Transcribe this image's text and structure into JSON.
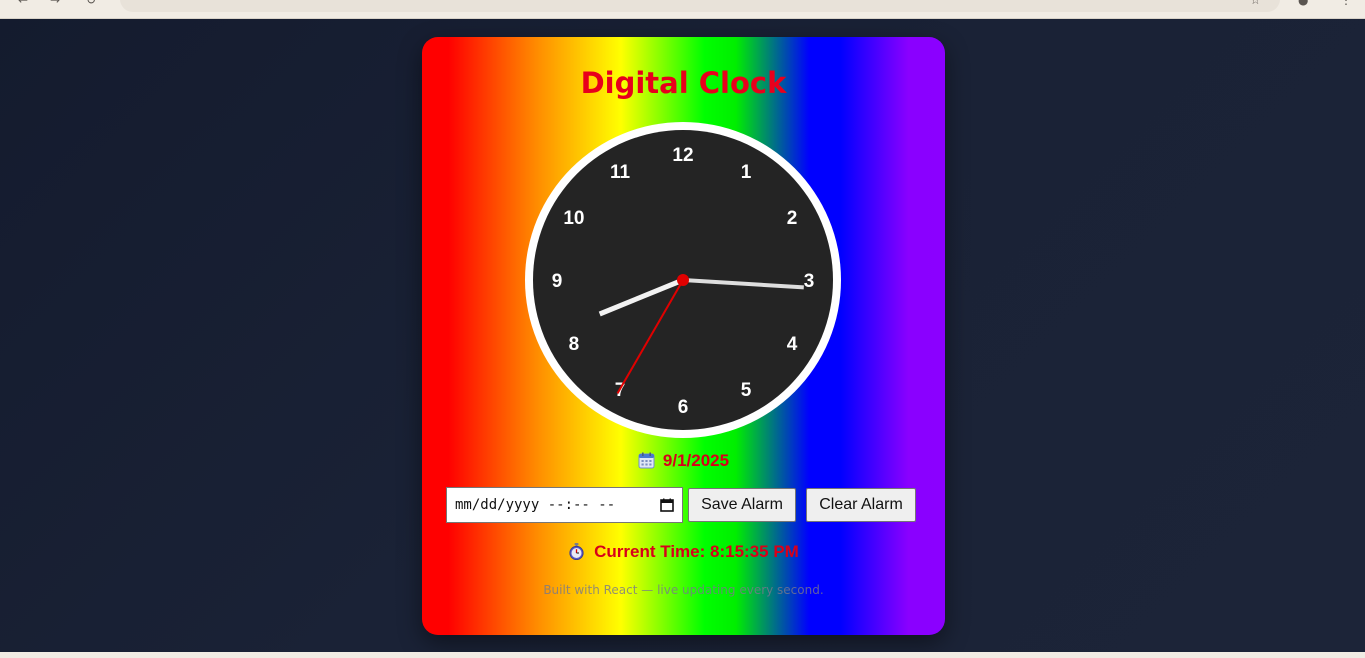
{
  "card": {
    "title": "Digital Clock",
    "date_text": "9/1/2025",
    "date_icon": "calendar-icon",
    "alarm": {
      "input_value": "mm/dd/yyyy --:-- --",
      "save_label": "Save Alarm",
      "clear_label": "Clear Alarm"
    },
    "current_time_text": "Current Time: 8:15:35 PM",
    "time_icon": "stopwatch-icon",
    "footer_text": "Built with React — live updating every second."
  },
  "clock": {
    "numbers": [
      "12",
      "1",
      "2",
      "3",
      "4",
      "5",
      "6",
      "7",
      "8",
      "9",
      "10",
      "11"
    ],
    "time": {
      "hours": 8,
      "minutes": 15,
      "seconds": 35
    }
  },
  "colors": {
    "title": "#e8001c",
    "accent_text": "#d8001a",
    "clock_face": "#242424",
    "clock_rim": "#ffffff",
    "second_hand": "#e00000",
    "page_background": "#161d30"
  }
}
